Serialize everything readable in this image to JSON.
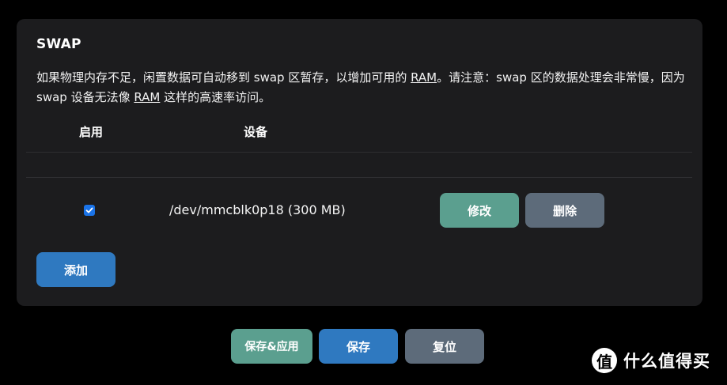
{
  "section": {
    "title": "SWAP",
    "description_part1": "如果物理内存不足，闲置数据可自动移到 swap 区暂存，以增加可用的 ",
    "description_link1": "RAM",
    "description_part2": "。请注意：swap 区的数据处理会非常慢，因为 swap 设备无法像 ",
    "description_link2": "RAM",
    "description_part3": " 这样的高速率访问。"
  },
  "table": {
    "headers": {
      "enable": "启用",
      "device": "设备"
    },
    "rows": [
      {
        "enabled": true,
        "device": "/dev/mmcblk0p18 (300 MB)",
        "edit_label": "修改",
        "delete_label": "删除"
      }
    ]
  },
  "actions": {
    "add_label": "添加"
  },
  "footer": {
    "save_apply_label": "保存&应用",
    "save_label": "保存",
    "reset_label": "复位"
  },
  "watermark": {
    "logo_glyph": "值",
    "text": "什么值得买"
  },
  "colors": {
    "page_bg": "#000000",
    "card_bg": "#1c1c1e",
    "teal_button": "#5b9f8f",
    "gray_button": "#5d6b7a",
    "blue_button": "#2f79c0",
    "checkbox": "#1a73e8"
  }
}
